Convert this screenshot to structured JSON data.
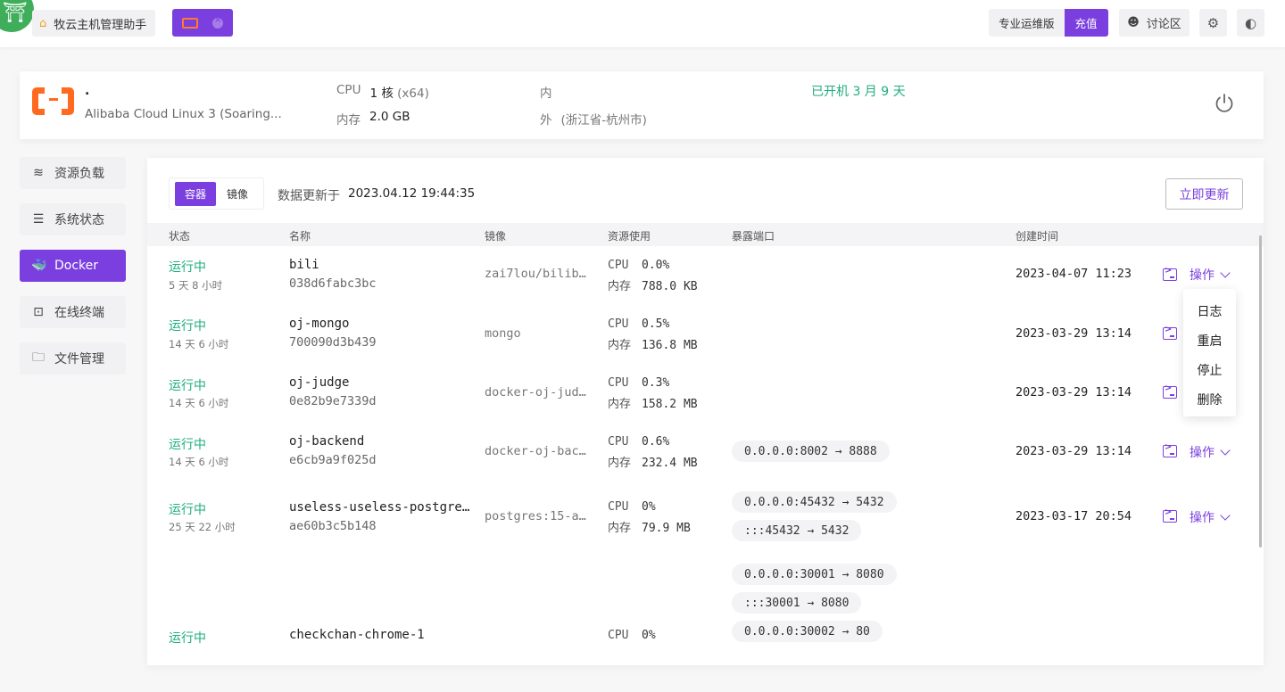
{
  "header": {
    "home_tab_label": "牧云主机管理助手",
    "pro_label": "专业运维版",
    "charge_label": "充值",
    "forum_label": "讨论区"
  },
  "server": {
    "name": ".",
    "os": "Alibaba Cloud Linux 3 (Soaring...",
    "cpu_label": "CPU",
    "cpu_value": "1 核",
    "cpu_arch": "(x64)",
    "mem_label": "内存",
    "mem_value": "2.0 GB",
    "inner_label": "内",
    "outer_label": "外",
    "outer_value": "(浙江省-杭州市)",
    "uptime": "已开机 3 月 9 天"
  },
  "sidebar": {
    "items": [
      {
        "label": "资源负载",
        "icon": "layers-icon"
      },
      {
        "label": "系统状态",
        "icon": "list-icon"
      },
      {
        "label": "Docker",
        "icon": "docker-icon"
      },
      {
        "label": "在线终端",
        "icon": "terminal-icon"
      },
      {
        "label": "文件管理",
        "icon": "folder-icon"
      }
    ],
    "active_index": 2
  },
  "main": {
    "tabs": [
      "容器",
      "镜像"
    ],
    "updated_label": "数据更新于",
    "updated_value": "2023.04.12 19:44:35",
    "refresh_label": "立即更新",
    "columns": [
      "状态",
      "名称",
      "镜像",
      "资源使用",
      "暴露端口",
      "创建时间"
    ],
    "cpu_label": "CPU",
    "mem_label": "内存",
    "ops_label": "操作",
    "rows": [
      {
        "status": "运行中",
        "since": "5 天 8 小时",
        "name": "bili",
        "id": "038d6fabc3bc",
        "image": "zai7lou/bilib…",
        "cpu": "0.0%",
        "mem": "788.0 KB",
        "ports": [],
        "created": "2023-04-07 11:23"
      },
      {
        "status": "运行中",
        "since": "14 天 6 小时",
        "name": "oj-mongo",
        "id": "700090d3b439",
        "image": "mongo",
        "cpu": "0.5%",
        "mem": "136.8 MB",
        "ports": [],
        "created": "2023-03-29 13:14"
      },
      {
        "status": "运行中",
        "since": "14 天 6 小时",
        "name": "oj-judge",
        "id": "0e82b9e7339d",
        "image": "docker-oj-jud…",
        "cpu": "0.3%",
        "mem": "158.2 MB",
        "ports": [],
        "created": "2023-03-29 13:14"
      },
      {
        "status": "运行中",
        "since": "14 天 6 小时",
        "name": "oj-backend",
        "id": "e6cb9a9f025d",
        "image": "docker-oj-bac…",
        "cpu": "0.6%",
        "mem": "232.4 MB",
        "ports": [
          "0.0.0.0:8002 → 8888"
        ],
        "created": "2023-03-29 13:14"
      },
      {
        "status": "运行中",
        "since": "25 天 22 小时",
        "name": "useless-useless-postgre…",
        "id": "ae60b3c5b148",
        "image": "postgres:15-a…",
        "cpu": "0%",
        "mem": "79.9 MB",
        "ports": [
          "0.0.0.0:45432 → 5432",
          ":::45432 → 5432"
        ],
        "created": "2023-03-17 20:54"
      },
      {
        "status": "运行中",
        "since": "",
        "name": "checkchan-chrome-1",
        "id": "",
        "image": "",
        "cpu": "0%",
        "mem": "",
        "ports": [
          "0.0.0.0:30001 → 8080",
          ":::30001 → 8080",
          "0.0.0.0:30002 → 80"
        ],
        "created": ""
      }
    ],
    "dropdown": [
      "日志",
      "重启",
      "停止",
      "删除"
    ]
  },
  "colors": {
    "accent": "#7b3fdf",
    "status_green": "#1fae7e",
    "aliyun_orange": "#ff6a1f",
    "logo_green": "#3fae5a"
  }
}
